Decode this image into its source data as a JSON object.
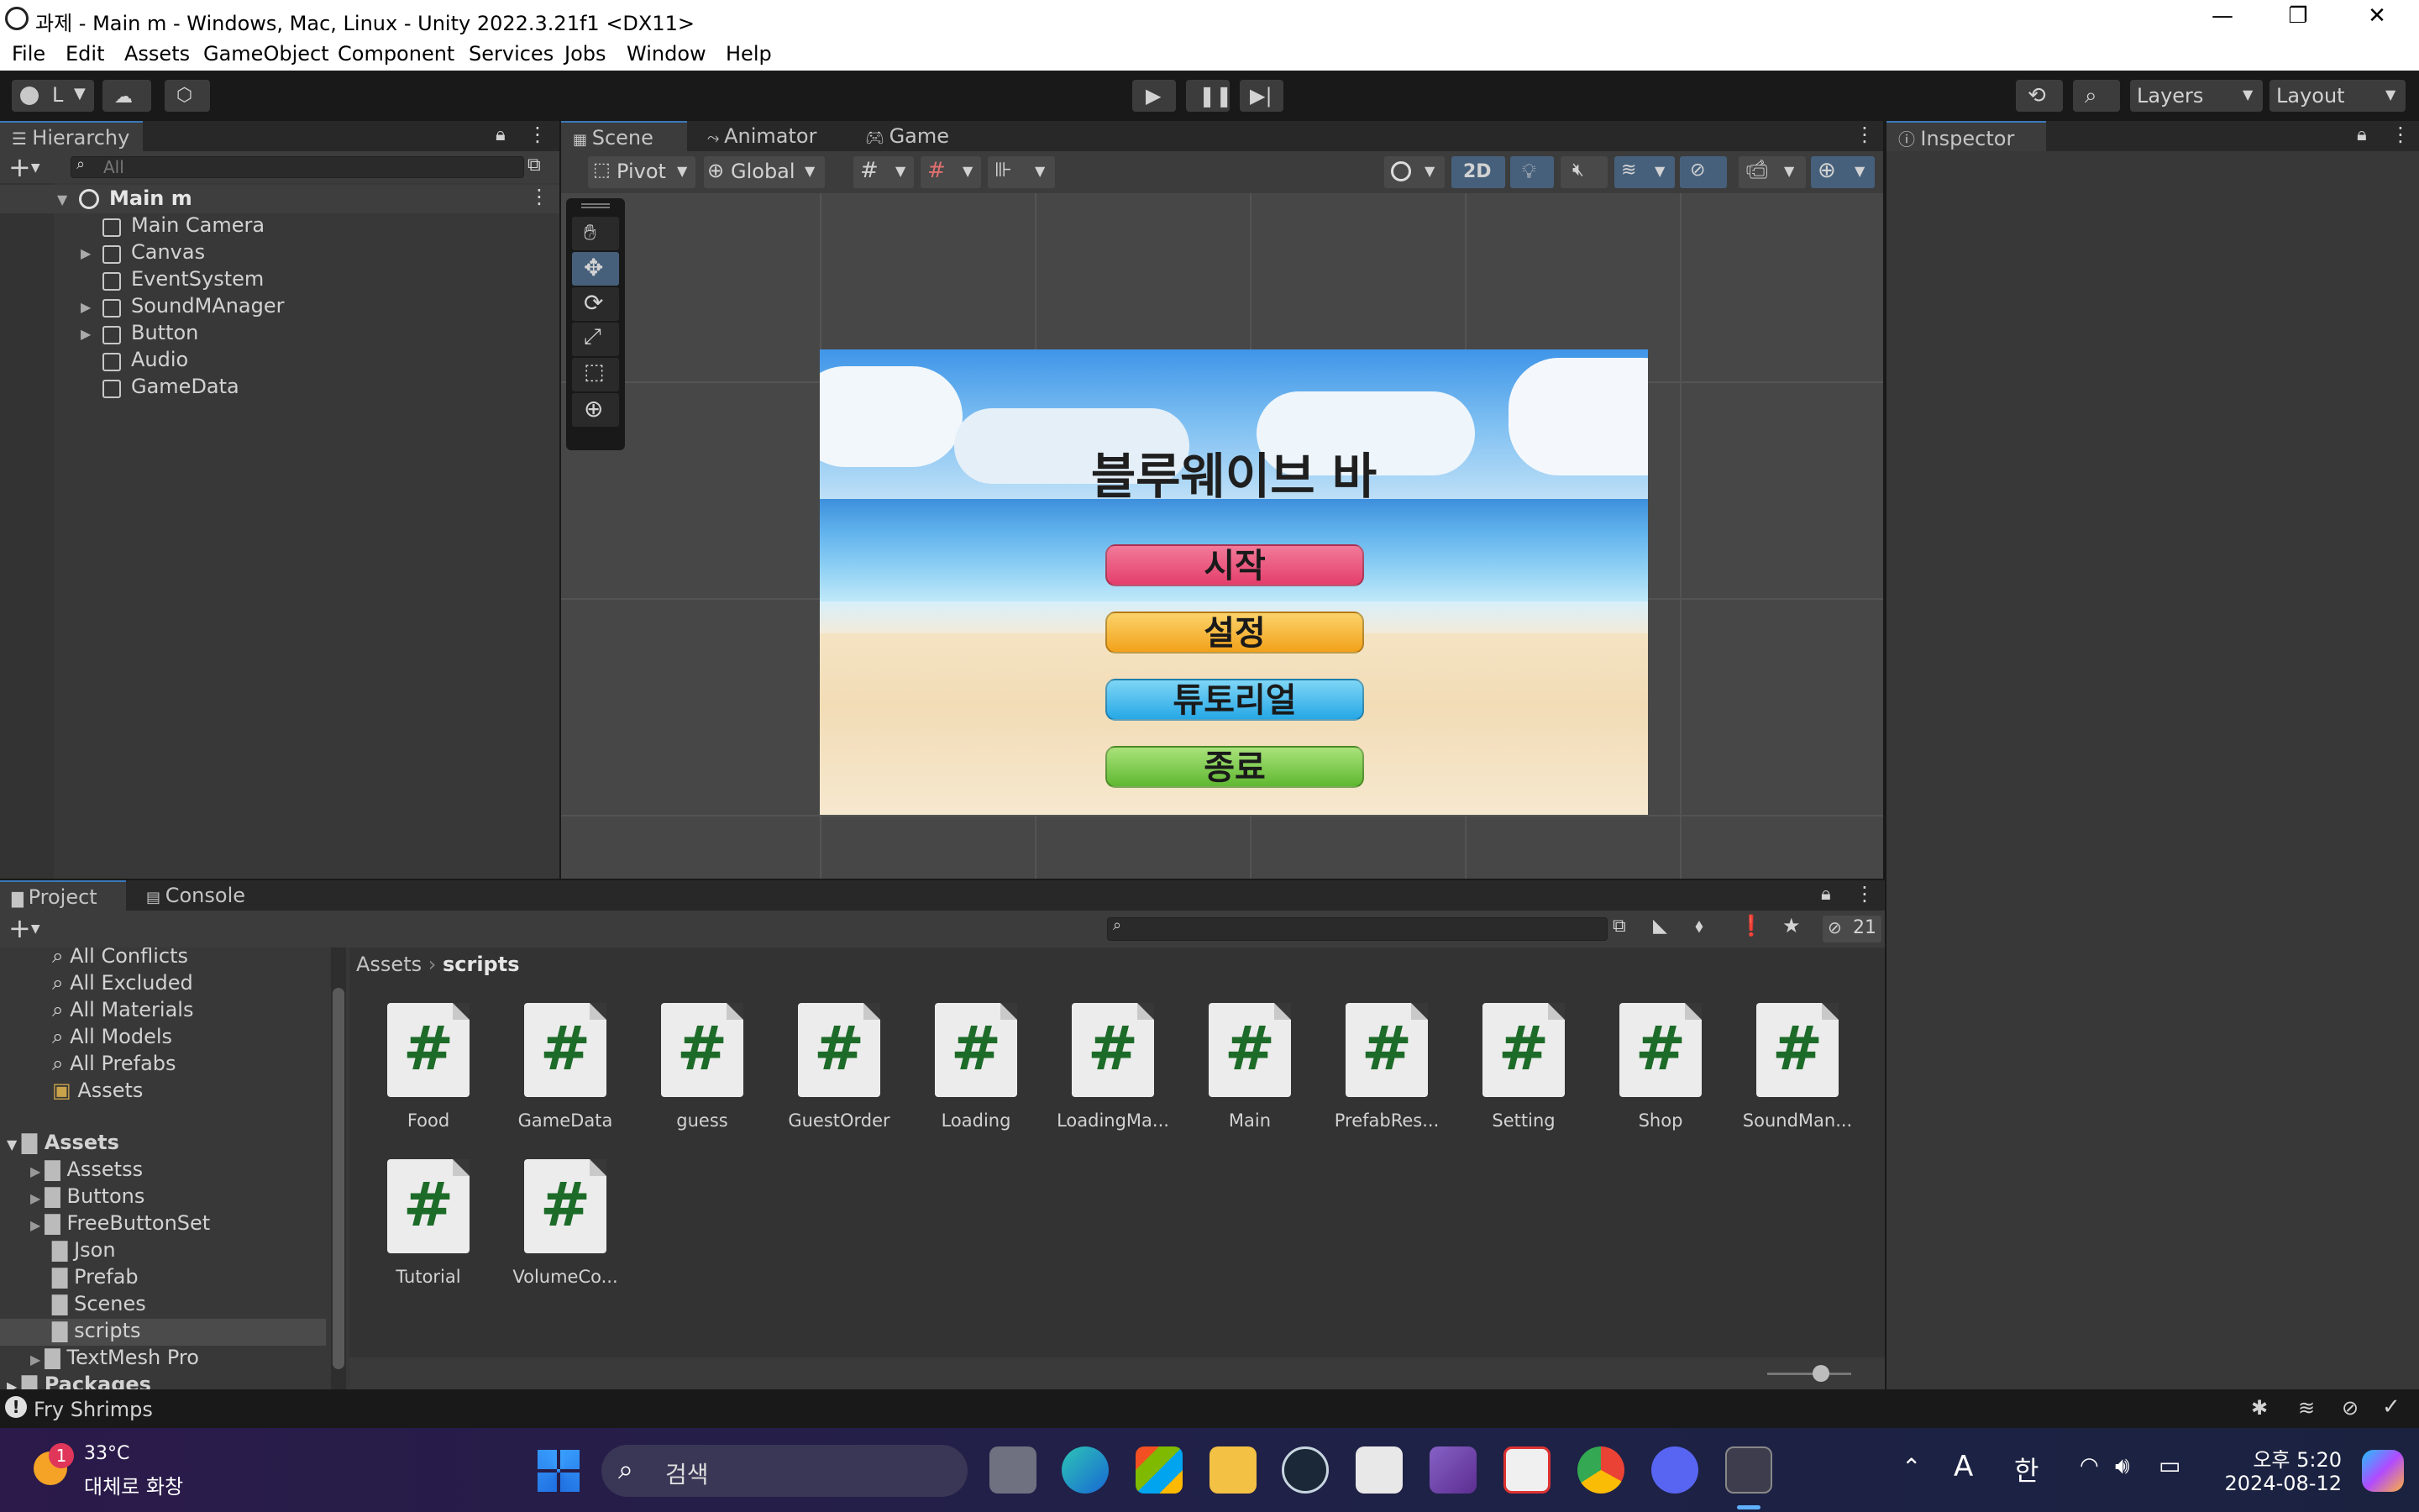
{
  "window": {
    "title": "과제 - Main m - Windows, Mac, Linux - Unity 2022.3.21f1 <DX11>",
    "controls": [
      "—",
      "❐",
      "✕"
    ]
  },
  "menu": [
    "File",
    "Edit",
    "Assets",
    "GameObject",
    "Component",
    "Services",
    "Jobs",
    "Window",
    "Help"
  ],
  "toolbar": {
    "account": "L",
    "layers": "Layers",
    "layout": "Layout"
  },
  "hierarchy": {
    "tab": "Hierarchy",
    "search_placeholder": "All",
    "scene": "Main m",
    "items": [
      {
        "name": "Main Camera",
        "expandable": false
      },
      {
        "name": "Canvas",
        "expandable": true
      },
      {
        "name": "EventSystem",
        "expandable": false
      },
      {
        "name": "SoundMAnager",
        "expandable": true
      },
      {
        "name": "Button",
        "expandable": true
      },
      {
        "name": "Audio",
        "expandable": false
      },
      {
        "name": "GameData",
        "expandable": false
      }
    ]
  },
  "scene": {
    "tabs": [
      "Scene",
      "Animator",
      "Game"
    ],
    "pivot": "Pivot",
    "global": "Global",
    "mode_2d": "2D",
    "game": {
      "title": "블루웨이브 바",
      "buttons": [
        {
          "label": "시작",
          "color": "#e8436e"
        },
        {
          "label": "설정",
          "color": "#f4a61c"
        },
        {
          "label": "튜토리얼",
          "color": "#2fb0ea"
        },
        {
          "label": "종료",
          "color": "#6cc03a"
        }
      ]
    }
  },
  "inspector": {
    "tab": "Inspector"
  },
  "project": {
    "tabs": [
      "Project",
      "Console"
    ],
    "hidden_count": "21",
    "favorites": [
      "All Conflicts",
      "All Excluded",
      "All Materials",
      "All Models",
      "All Prefabs",
      "Assets"
    ],
    "assets_root": "Assets",
    "folders": [
      "Assetss",
      "Buttons",
      "FreeButtonSet",
      "Json",
      "Prefab",
      "Scenes",
      "scripts",
      "TextMesh Pro"
    ],
    "packages": "Packages",
    "breadcrumb": [
      "Assets",
      "scripts"
    ],
    "scripts": [
      "Food",
      "GameData",
      "guess",
      "GuestOrder",
      "Loading",
      "LoadingMa...",
      "Main",
      "PrefabRes...",
      "Setting",
      "Shop",
      "SoundMan...",
      "Tutorial",
      "VolumeCo..."
    ]
  },
  "status": {
    "message": "Fry Shrimps"
  },
  "taskbar": {
    "weather_temp": "33°C",
    "weather_desc": "대체로 화창",
    "weather_badge": "1",
    "search_placeholder": "검색",
    "ime_a": "A",
    "ime_han": "한",
    "time": "오후 5:20",
    "date": "2024-08-12"
  }
}
